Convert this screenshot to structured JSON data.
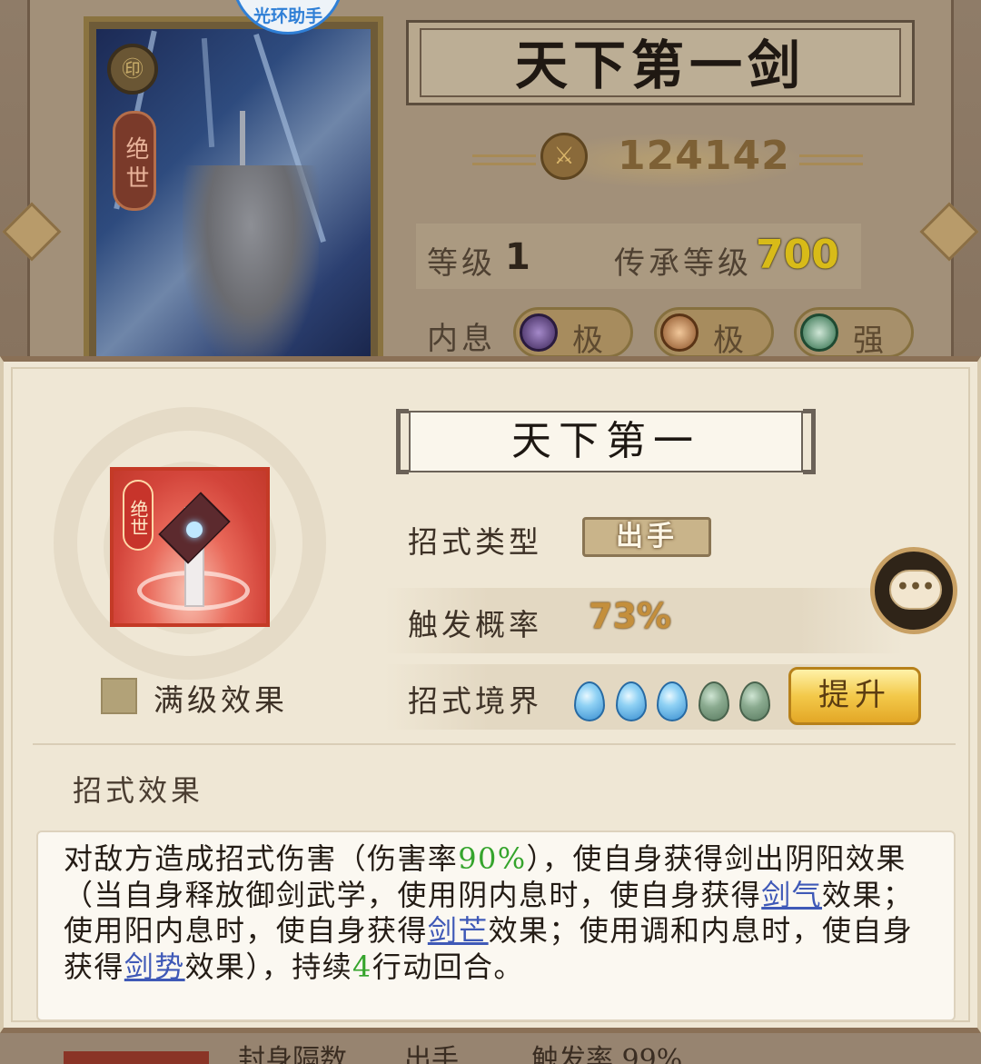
{
  "watermark": {
    "text": "光环助手"
  },
  "hero": {
    "rank_tag": "绝世",
    "name": "天下第一剑",
    "power": "124142",
    "level_label": "等级",
    "level_value": "1",
    "inherit_label": "传承等级",
    "inherit_value": "700",
    "neixi_label": "内息",
    "neixi": [
      {
        "grade": "极",
        "color": "#4b2f6e"
      },
      {
        "grade": "极",
        "color": "#8a5a2a"
      },
      {
        "grade": "强",
        "color": "#2f6e4a"
      }
    ]
  },
  "skill": {
    "tag": "绝世",
    "name": "天下第一",
    "max_level_label": "满级效果",
    "type_label": "招式类型",
    "type_value": "出手",
    "rate_label": "触发概率",
    "rate_value": "73%",
    "realm_label": "招式境界",
    "realm_filled": 3,
    "realm_total": 5,
    "upgrade_label": "提升",
    "chat_glyph": "•••",
    "effect_title": "招式效果",
    "effect": {
      "p1": "对敌方造成招式伤害（伤害率",
      "v1": "90%",
      "p2": "），使自身获得剑出阴阳效果（当自身释放御剑武学，使用阴内息时，使自身获得",
      "l1": "剑气",
      "p3": "效果；使用阳内息时，使自身获得",
      "l2": "剑芒",
      "p4": "效果；使用调和内息时，使自身获得",
      "l3": "剑势",
      "p5": "效果），持续",
      "v2": "4",
      "p6": "行动回合。"
    }
  },
  "bottom_peek": {
    "name_partial": "封身隔数",
    "type_partial": "出手",
    "rate_partial": "触发率 99%"
  },
  "colors": {
    "green": "#35a42c",
    "link": "#3f59b7",
    "rate": "#c48f3c",
    "inherit": "#f0d020"
  }
}
